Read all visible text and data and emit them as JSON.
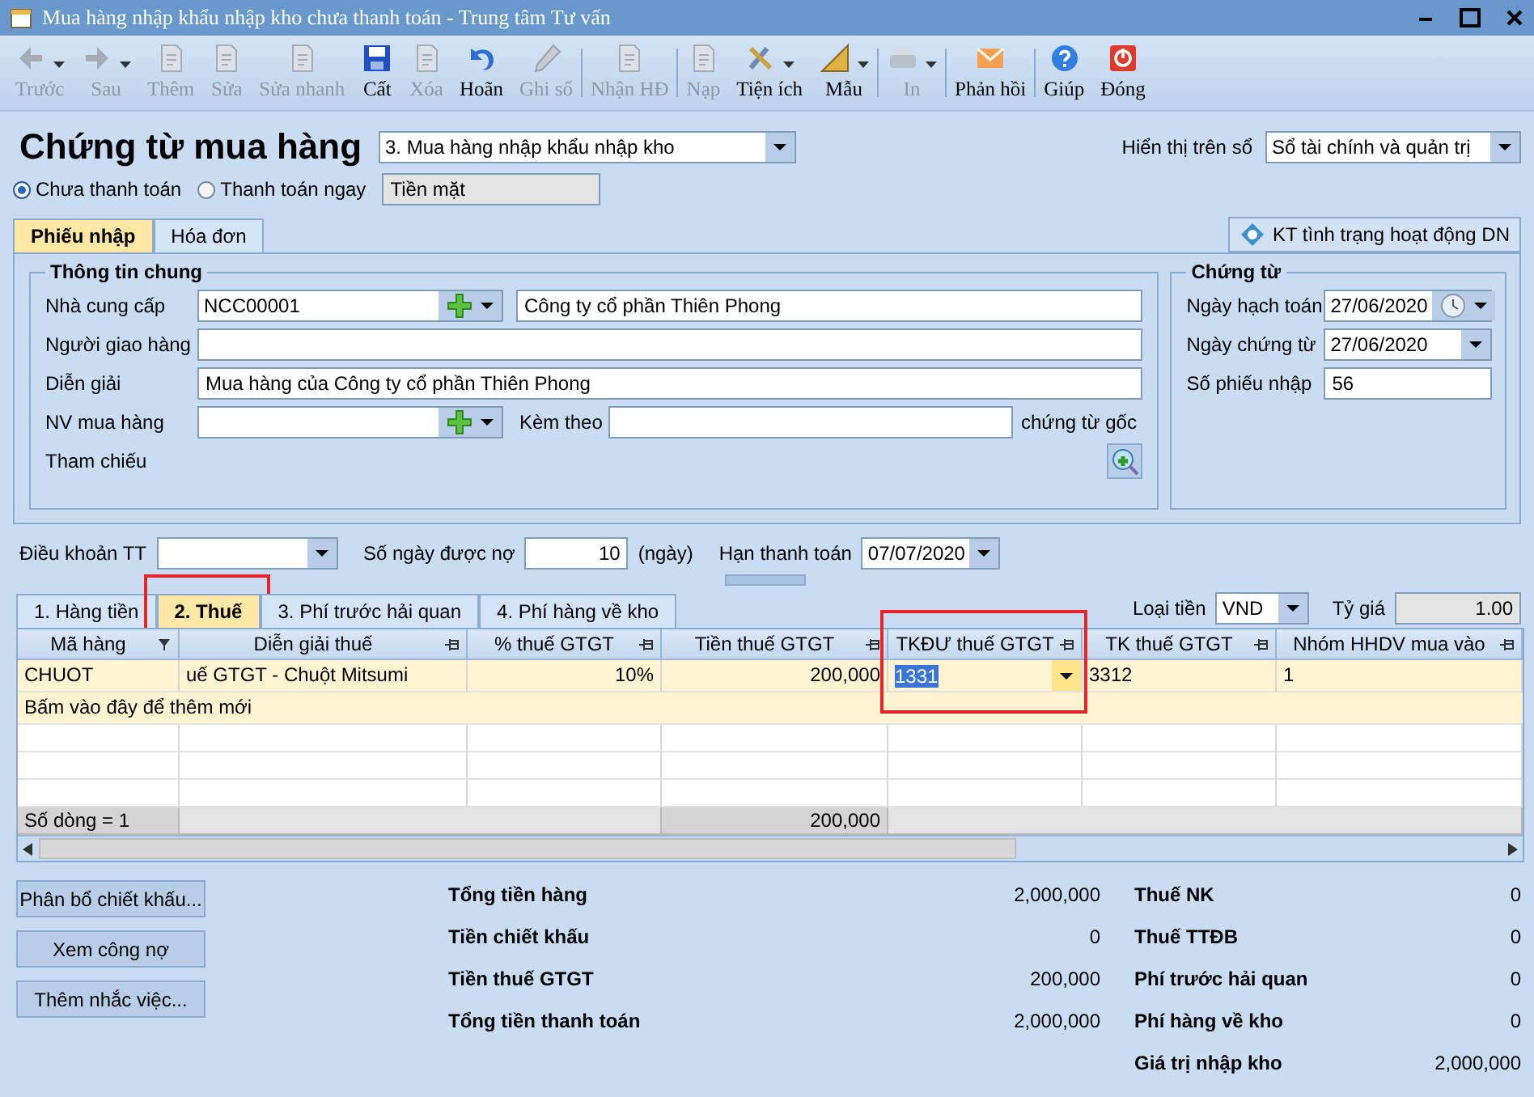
{
  "window": {
    "title": "Mua hàng nhập khẩu nhập kho chưa thanh toán - Trung tâm Tư vấn"
  },
  "toolbar": [
    {
      "label": "Trước",
      "disabled": true,
      "dropdown": true
    },
    {
      "label": "Sau",
      "disabled": true,
      "dropdown": true
    },
    {
      "label": "Thêm",
      "disabled": true,
      "dropdown": false
    },
    {
      "label": "Sửa",
      "disabled": true,
      "dropdown": false
    },
    {
      "label": "Sửa nhanh",
      "disabled": true,
      "dropdown": false
    },
    {
      "label": "Cất",
      "disabled": false,
      "dropdown": false
    },
    {
      "label": "Xóa",
      "disabled": true,
      "dropdown": false
    },
    {
      "label": "Hoãn",
      "disabled": false,
      "dropdown": false
    },
    {
      "label": "Ghi sổ",
      "disabled": true,
      "dropdown": false
    },
    {
      "label": "Nhận HĐ",
      "disabled": true,
      "dropdown": false
    },
    {
      "label": "Nạp",
      "disabled": true,
      "dropdown": false
    },
    {
      "label": "Tiện ích",
      "disabled": false,
      "dropdown": true
    },
    {
      "label": "Mẫu",
      "disabled": false,
      "dropdown": true
    },
    {
      "label": "In",
      "disabled": true,
      "dropdown": true
    },
    {
      "label": "Phản hồi",
      "disabled": false,
      "dropdown": false
    },
    {
      "label": "Giúp",
      "disabled": false,
      "dropdown": false
    },
    {
      "label": "Đóng",
      "disabled": false,
      "dropdown": false
    }
  ],
  "header": {
    "title": "Chứng từ mua hàng",
    "voucher_type": "3. Mua hàng nhập khẩu nhập kho",
    "ledger_label": "Hiển thị trên sổ",
    "ledger_value": "Sổ tài chính và quản trị"
  },
  "payment": {
    "options": [
      {
        "label": "Chưa thanh toán",
        "selected": true
      },
      {
        "label": "Thanh toán ngay",
        "selected": false
      }
    ],
    "method": "Tiền mặt"
  },
  "tabs": [
    {
      "label": "Phiếu nhập",
      "selected": true
    },
    {
      "label": "Hóa đơn",
      "selected": false
    }
  ],
  "check_button": "KT tình trạng hoạt động DN",
  "general": {
    "title": "Thông tin chung",
    "supplier_label": "Nhà cung cấp",
    "supplier_code": "NCC00001",
    "supplier_name": "Công ty cổ phần Thiên Phong",
    "deliverer_label": "Người giao hàng",
    "description_label": "Diễn giải",
    "description": "Mua hàng của Công ty cổ phần Thiên Phong",
    "buyer_label": "NV mua hàng",
    "attach_label": "Kèm theo",
    "attach_suffix": "chứng từ gốc",
    "reference_label": "Tham chiếu"
  },
  "voucher": {
    "title": "Chứng từ",
    "fields": [
      {
        "label": "Ngày hạch toán",
        "value": "27/06/2020",
        "kind": "date_clock"
      },
      {
        "label": "Ngày chứng từ",
        "value": "27/06/2020",
        "kind": "date"
      },
      {
        "label": "Số phiếu nhập",
        "value": "56",
        "kind": "text"
      }
    ]
  },
  "terms": {
    "terms_label": "Điều khoản TT",
    "days_label": "Số ngày được nợ",
    "days": "10",
    "days_unit": "(ngày)",
    "due_label": "Hạn thanh toán",
    "due": "07/07/2020"
  },
  "detail_tabs": [
    {
      "label": "1. Hàng tiền",
      "selected": false,
      "highlighted": false
    },
    {
      "label": "2. Thuế",
      "selected": true,
      "highlighted": true
    },
    {
      "label": "3. Phí trước hải quan",
      "selected": false,
      "highlighted": false
    },
    {
      "label": "4. Phí hàng về kho",
      "selected": false,
      "highlighted": false
    }
  ],
  "currency": {
    "label": "Loại tiền",
    "value": "VND",
    "rate_label": "Tỷ giá",
    "rate": "1.00"
  },
  "table": {
    "columns": [
      {
        "label": "Mã hàng",
        "highlighted": false
      },
      {
        "label": "Diễn giải thuế",
        "highlighted": false
      },
      {
        "label": "% thuế GTGT",
        "highlighted": false
      },
      {
        "label": "Tiền thuế GTGT",
        "highlighted": false
      },
      {
        "label": "TKĐƯ thuế GTGT",
        "highlighted": true
      },
      {
        "label": "TK thuế GTGT",
        "highlighted": false
      },
      {
        "label": "Nhóm HHDV mua vào",
        "highlighted": false
      }
    ],
    "rows": [
      {
        "cells": [
          {
            "text": "CHUOT",
            "editing": false
          },
          {
            "text": "uế GTGT - Chuột Mitsumi",
            "editing": false
          },
          {
            "text": "10%",
            "editing": false
          },
          {
            "text": "200,000",
            "editing": false
          },
          {
            "text": "1331",
            "editing": true
          },
          {
            "text": "3312",
            "editing": false
          },
          {
            "text": "1",
            "editing": false
          }
        ]
      }
    ],
    "add_row": "Bấm vào đây để thêm mới",
    "footer": {
      "count": "Số dòng = 1",
      "tax_total": "200,000"
    }
  },
  "actions": [
    "Phân bổ chiết khấu...",
    "Xem công nợ",
    "Thêm nhắc việc..."
  ],
  "totals_left": [
    {
      "label": "Tổng tiền hàng",
      "value": "2,000,000"
    },
    {
      "label": "Tiền chiết khấu",
      "value": "0"
    },
    {
      "label": "Tiền thuế GTGT",
      "value": "200,000"
    },
    {
      "label": "Tổng tiền thanh toán",
      "value": "2,000,000"
    }
  ],
  "totals_right": [
    {
      "label": "Thuế NK",
      "value": "0"
    },
    {
      "label": "Thuế TTĐB",
      "value": "0"
    },
    {
      "label": "Phí trước hải quan",
      "value": "0"
    },
    {
      "label": "Phí hàng về kho",
      "value": "0"
    },
    {
      "label": "Giá trị nhập kho",
      "value": "2,000,000"
    }
  ]
}
